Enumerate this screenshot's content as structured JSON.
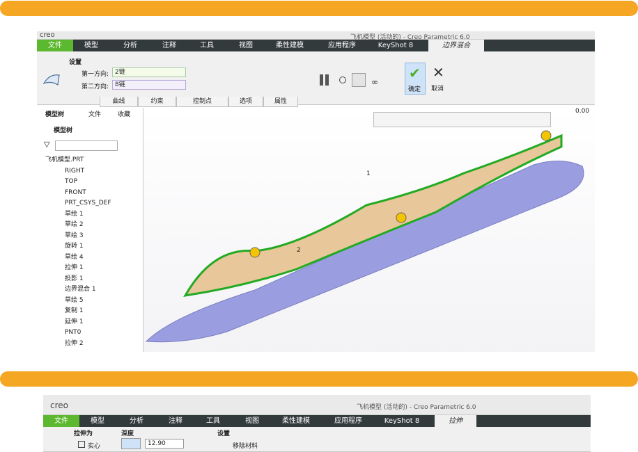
{
  "screen1": {
    "window_title": "飞机模型 (活动的) - Creo Parametric 6.0",
    "app_logo": "creo",
    "tabs": [
      "文件",
      "模型",
      "分析",
      "注释",
      "工具",
      "视图",
      "柔性建模",
      "应用程序",
      "KeyShot 8",
      "边界混合"
    ],
    "ribbon": {
      "group_title": "设置",
      "dir1_label": "第一方向:",
      "dir1_value": "2链",
      "dir2_label": "第二方向:",
      "dir2_value": "8链",
      "confirm_label": "确定",
      "cancel_label": "取消"
    },
    "subtabs": [
      "曲线",
      "约束",
      "控制点",
      "选项",
      "属性"
    ],
    "tree": {
      "tabs": [
        "模型树",
        "文件",
        "收藏"
      ],
      "toolbar_label": "模型树",
      "items": [
        "飞机模型.PRT",
        "RIGHT",
        "TOP",
        "FRONT",
        "PRT_CSYS_DEF",
        "草绘 1",
        "草绘 2",
        "草绘 3",
        "旋转 1",
        "草绘 4",
        "拉伸 1",
        "投影 1",
        "边界混合 1",
        "草绘 5",
        "复制 1",
        "延伸 1",
        "PNT0",
        "拉伸 2"
      ]
    },
    "callouts": [
      "1",
      "2",
      "0.00"
    ]
  },
  "screen2": {
    "window_title": "飞机模型 (活动的) - Creo Parametric 6.0",
    "app_logo": "creo",
    "tabs": [
      "文件",
      "模型",
      "分析",
      "注释",
      "工具",
      "视图",
      "柔性建模",
      "应用程序",
      "KeyShot 8",
      "拉伸"
    ],
    "ribbon": {
      "type_title": "拉伸为",
      "solid_label": "实心",
      "depth_title": "深度",
      "depth_value": "12.90",
      "settings_title": "设置",
      "remove_material_label": "移除材料"
    }
  },
  "colors": {
    "banner": "#f5a623",
    "tab_bar": "#333a3c",
    "file_tab": "#5cb82e",
    "fuselage": "#9a9ee0",
    "surface": "#e8c79a",
    "boundary": "#22aa22"
  }
}
